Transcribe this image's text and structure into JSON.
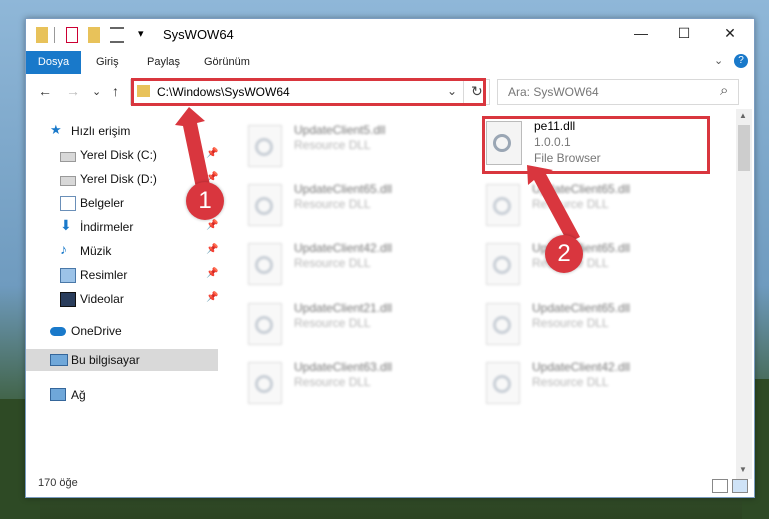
{
  "window": {
    "title": "SysWOW64",
    "controls": {
      "minimize": "—",
      "maximize": "☐",
      "close": "✕"
    },
    "quick_access_dropdown": "▾"
  },
  "ribbon": {
    "file_tab": "Dosya",
    "tabs": [
      "Giriş",
      "Paylaş",
      "Görünüm"
    ],
    "collapse": "⌄",
    "help": "?"
  },
  "navigation": {
    "back": "←",
    "forward": "→",
    "recent": "⌄",
    "up": "↑",
    "address": "C:\\Windows\\SysWOW64",
    "address_dropdown": "⌄",
    "refresh": "↻",
    "search_placeholder": "Ara: SysWOW64",
    "search_icon": "⌕"
  },
  "sidebar": {
    "quick_access": "Hızlı erişim",
    "items": [
      {
        "label": "Yerel Disk (C:)",
        "icon": "drive-icon",
        "pinned": true
      },
      {
        "label": "Yerel Disk (D:)",
        "icon": "drive-icon",
        "pinned": true
      },
      {
        "label": "Belgeler",
        "icon": "documents-icon",
        "pinned": true
      },
      {
        "label": "İndirmeler",
        "icon": "downloads-icon",
        "pinned": true
      },
      {
        "label": "Müzik",
        "icon": "music-icon",
        "pinned": true
      },
      {
        "label": "Resimler",
        "icon": "pictures-icon",
        "pinned": true
      },
      {
        "label": "Videolar",
        "icon": "videos-icon",
        "pinned": true
      }
    ],
    "onedrive": "OneDrive",
    "this_pc": "Bu bilgisayar",
    "network": "Ağ"
  },
  "files": {
    "left_column": [
      {
        "name": "UpdateClient5.dll",
        "sub": "Resource DLL"
      },
      {
        "name": "UpdateClient65.dll",
        "sub": "Resource DLL"
      },
      {
        "name": "UpdateClient42.dll",
        "sub": "Resource DLL"
      },
      {
        "name": "UpdateClient21.dll",
        "sub": "Resource DLL"
      },
      {
        "name": "UpdateClient63.dll",
        "sub": "Resource DLL"
      }
    ],
    "highlighted": {
      "name": "pe11.dll",
      "version": "1.0.0.1",
      "description": "File Browser"
    },
    "right_column": [
      {
        "name": "UpdateClient65.dll",
        "sub": "Resource DLL"
      },
      {
        "name": "UpdateClient65.dll",
        "sub": "Resource DLL"
      },
      {
        "name": "UpdateClient65.dll",
        "sub": "Resource DLL"
      },
      {
        "name": "UpdateClient42.dll",
        "sub": "Resource DLL"
      }
    ]
  },
  "status": {
    "count": "170 öğe"
  },
  "annotations": {
    "step1": "1",
    "step2": "2"
  },
  "colors": {
    "accent": "#1979ca",
    "highlight": "#d9363e"
  }
}
